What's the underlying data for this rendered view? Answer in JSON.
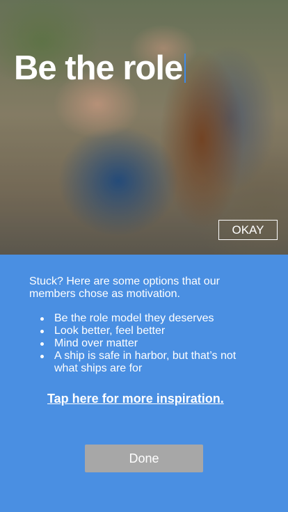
{
  "hero": {
    "title": "Be the role",
    "okay_label": "OKAY"
  },
  "panel": {
    "intro": "Stuck? Here are some options that our members chose as motivation.",
    "options": [
      "Be the role model they deserves",
      "Look better, feel better",
      "Mind over matter",
      "A ship is safe in harbor, but that’s not what ships are for"
    ],
    "more_link": "Tap here for more inspiration.",
    "done_label": "Done"
  },
  "colors": {
    "panel_bg": "#4a8fe2",
    "done_button": "#a7a7a7",
    "caret": "#3d8be8"
  }
}
